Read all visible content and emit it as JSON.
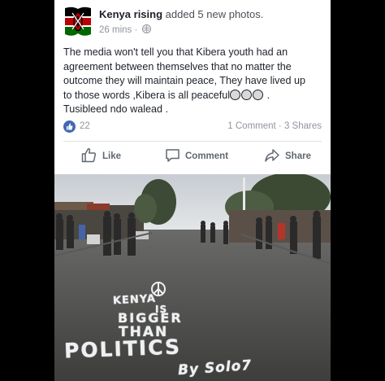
{
  "post": {
    "author": "Kenya rising",
    "action": "added 5 new photos.",
    "time": "26 mins",
    "separator": "·",
    "text_line1": "The media won't tell you that Kibera youth had an",
    "text_line2": "agreement between themselves that no matter the",
    "text_line3": "outcome they will maintain peace,  They have lived up",
    "text_line4": "to those words ,Kibera is all peaceful",
    "text_line4_end": ".",
    "text_line5": "Tusibleed ndo walead .",
    "likes": "22",
    "comments": "1 Comment",
    "shares": "3 Shares",
    "stats_separator": "·"
  },
  "actions": {
    "like": "Like",
    "comment": "Comment",
    "share": "Share"
  },
  "photo": {
    "road_line1": "KENYA",
    "road_line2": "IS",
    "road_line3": "BIGGER",
    "road_line4": "THAN",
    "road_line5": "POLITICS",
    "road_signature": "By Solo7"
  },
  "colors": {
    "brand_blue": "#4267b2",
    "flag_black": "#000000",
    "flag_red": "#bb0000",
    "flag_green": "#006600"
  },
  "icons": [
    "kenya-flag-avatar",
    "globe-icon",
    "like-reaction-icon",
    "thumbs-up-icon",
    "comment-icon",
    "share-icon",
    "peace-symbol"
  ]
}
